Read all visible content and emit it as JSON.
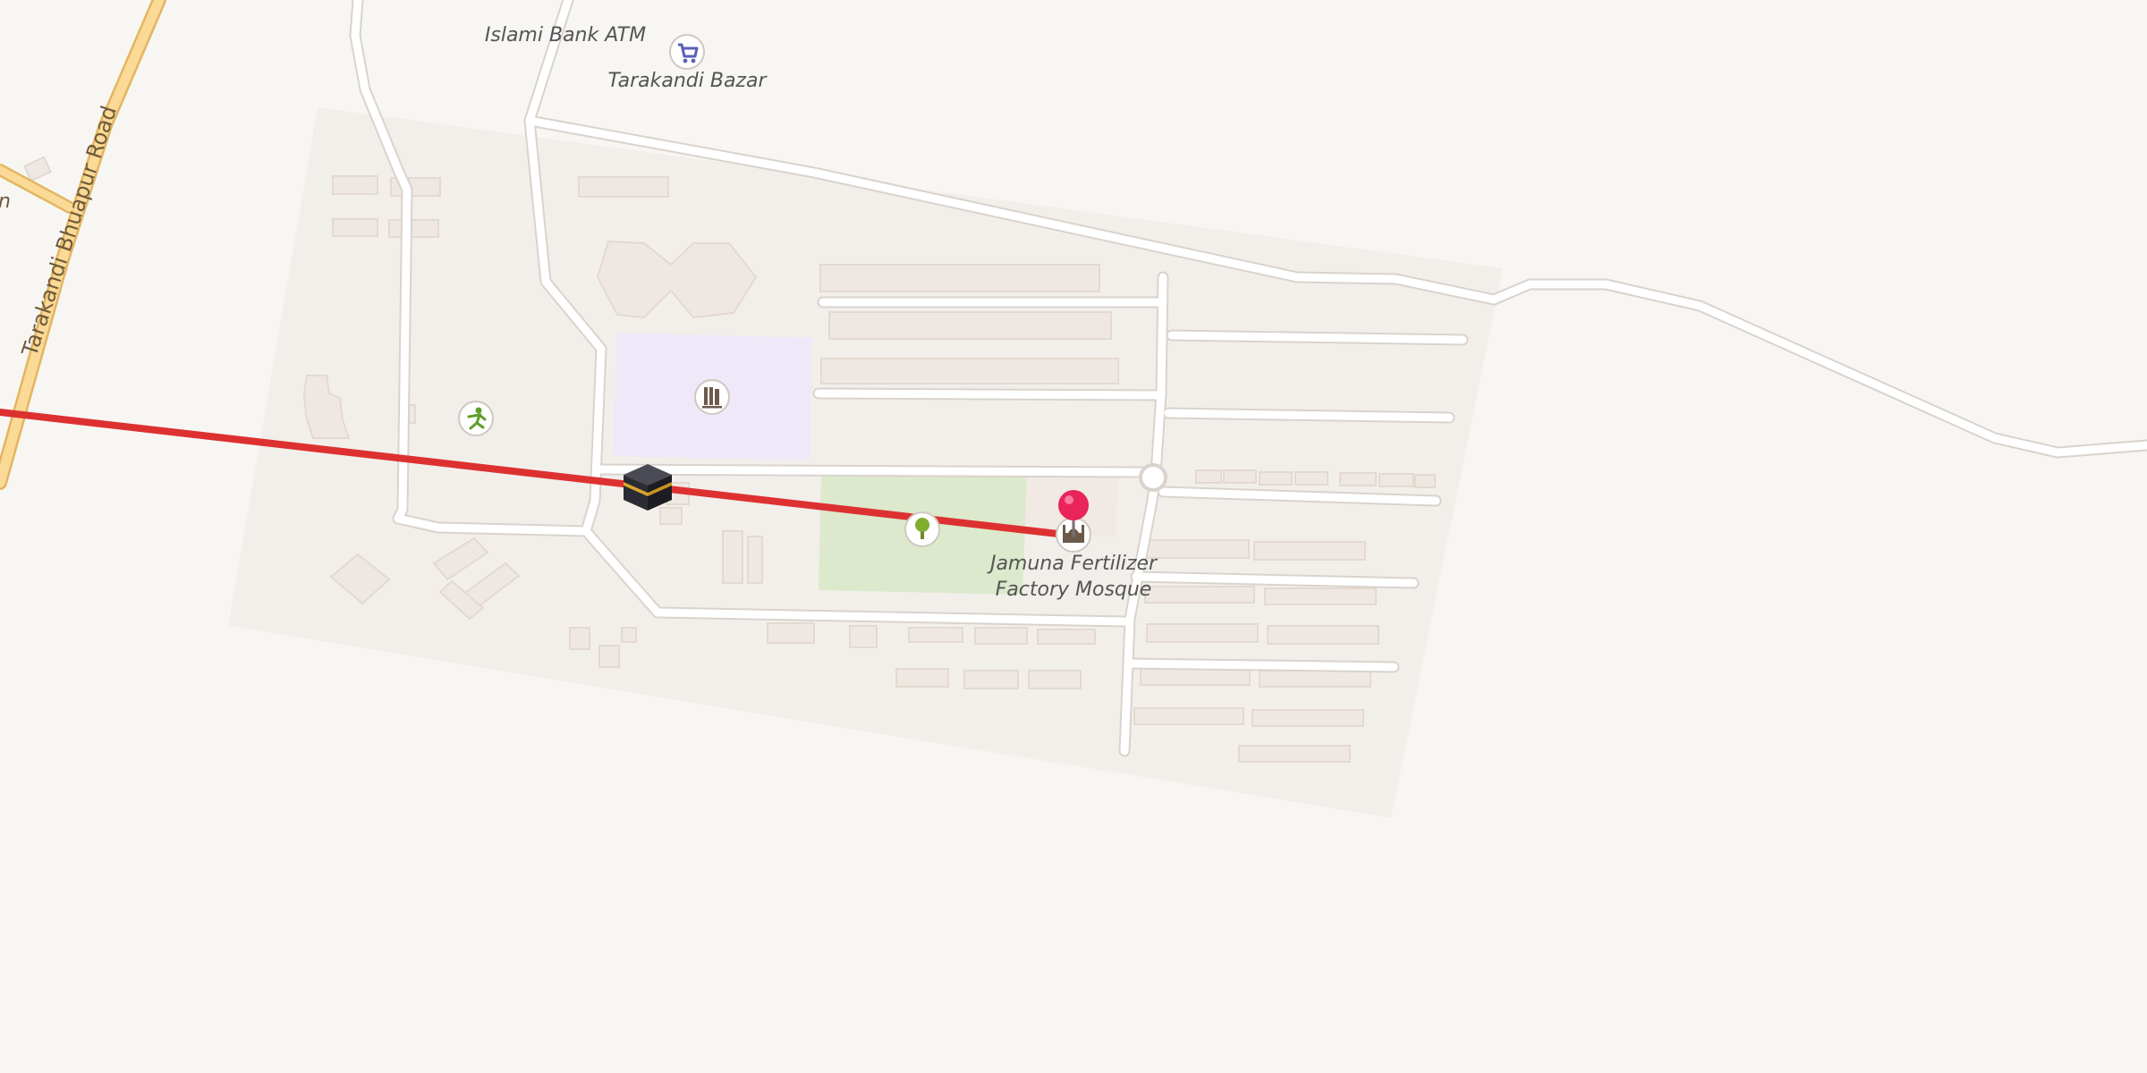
{
  "map": {
    "roads": {
      "main_road_name": "Tarakandi Bhuapur Road",
      "cut_label": "n"
    },
    "places": {
      "atm": "Islami Bank ATM",
      "bazar": "Tarakandi Bazar",
      "mosque_line1": "Jamuna Fertilizer",
      "mosque_line2": "Factory Mosque"
    },
    "icons": {
      "bazar": "shopping-cart-icon",
      "library": "library-icon",
      "sports": "sports-icon",
      "park": "tree-icon",
      "mosque": "mosque-icon",
      "qibla": "kaaba-icon",
      "pin": "map-pin-icon"
    },
    "colors": {
      "background": "#f8f6f3",
      "site_area": "#f2efeb",
      "road_casing": "#d9d3cc",
      "road_fill": "#ffffff",
      "main_road_fill": "#fbd996",
      "main_road_casing": "#e2b660",
      "school": "#efe8f8",
      "park": "#dce9cc",
      "building": "#efe8e2",
      "qibla_line": "#dd3131",
      "pin": "#e8245a"
    }
  }
}
